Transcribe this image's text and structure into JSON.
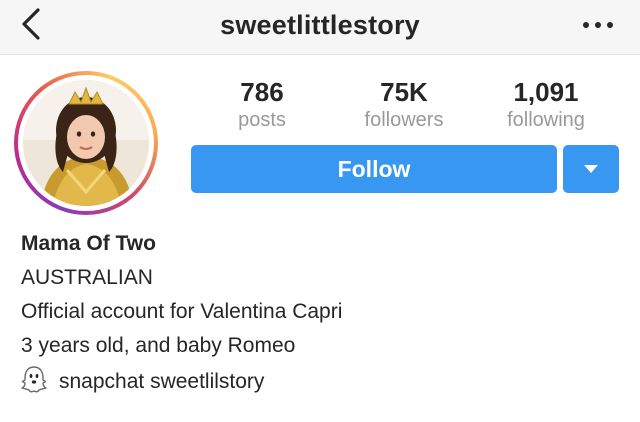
{
  "header": {
    "username": "sweetlittlestory",
    "back_icon": "chevron-left-icon",
    "more_icon": "more-dots-icon"
  },
  "profile": {
    "avatar_icon": "profile-avatar",
    "stats": {
      "posts": {
        "count": "786",
        "label": "posts"
      },
      "followers": {
        "count": "75K",
        "label": "followers"
      },
      "following": {
        "count": "1,091",
        "label": "following"
      }
    },
    "follow_label": "Follow",
    "dropdown_icon": "caret-down-icon"
  },
  "bio": {
    "name": "Mama Of Two",
    "lines": [
      "AUSTRALIAN",
      "Official account for Valentina Capri",
      "3 years old, and baby Romeo"
    ],
    "snapchat_icon": "ghost-icon",
    "snapchat_text": "snapchat sweetlilstory"
  },
  "colors": {
    "accent": "#3897f0",
    "text": "#262626",
    "muted": "#999999"
  }
}
